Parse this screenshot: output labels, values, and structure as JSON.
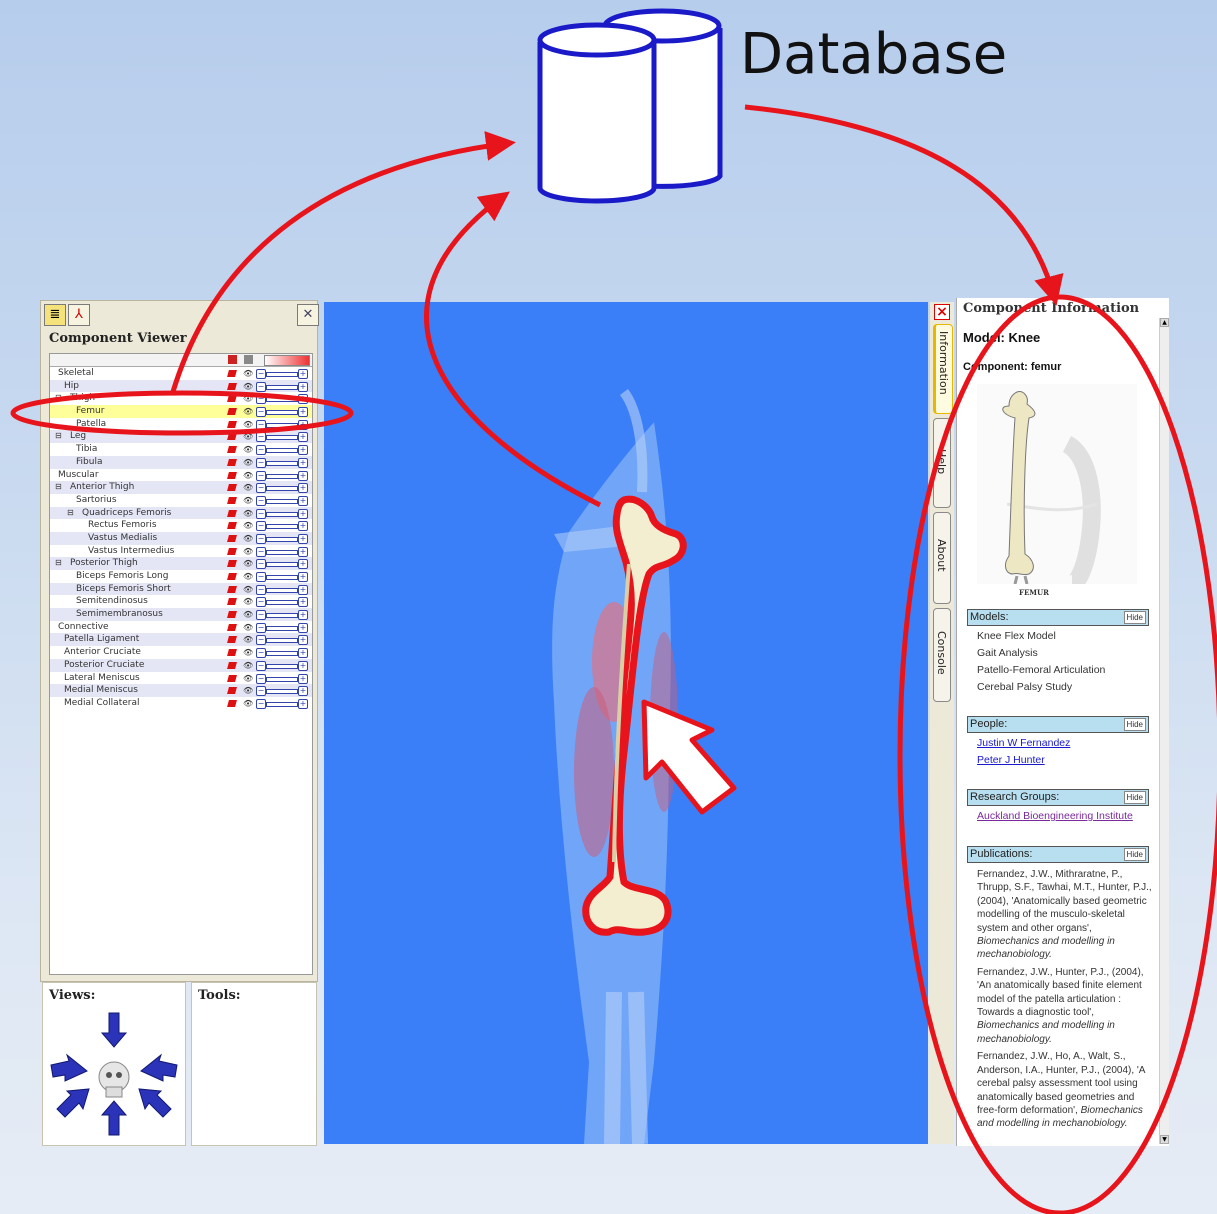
{
  "diagram": {
    "database_label": "Database"
  },
  "icons": {
    "database": "database-cylinders-icon",
    "cursor": "arrow-cursor-icon"
  },
  "colors": {
    "annotation_red": "#e8141c",
    "viewport_blue": "#3a7ef8",
    "selection_yellow": "#ffff99",
    "section_header": "#b8dfef"
  },
  "left_panel": {
    "title": "Component Viewer",
    "tree": [
      {
        "label": "Skeletal",
        "indent": 0,
        "expander": "⊟"
      },
      {
        "label": "Hip",
        "indent": 1,
        "expander": ""
      },
      {
        "label": "Thigh",
        "indent": 1,
        "expander": "⊟"
      },
      {
        "label": "Femur",
        "indent": 2,
        "expander": "",
        "selected": true
      },
      {
        "label": "Patella",
        "indent": 2,
        "expander": ""
      },
      {
        "label": "Leg",
        "indent": 1,
        "expander": "⊟"
      },
      {
        "label": "Tibia",
        "indent": 2,
        "expander": ""
      },
      {
        "label": "Fibula",
        "indent": 2,
        "expander": ""
      },
      {
        "label": "Muscular",
        "indent": 0,
        "expander": "⊟"
      },
      {
        "label": "Anterior Thigh",
        "indent": 1,
        "expander": "⊟"
      },
      {
        "label": "Sartorius",
        "indent": 2,
        "expander": ""
      },
      {
        "label": "Quadriceps Femoris",
        "indent": 2,
        "expander": "⊟"
      },
      {
        "label": "Rectus Femoris",
        "indent": 3,
        "expander": ""
      },
      {
        "label": "Vastus Medialis",
        "indent": 3,
        "expander": ""
      },
      {
        "label": "Vastus Intermedius",
        "indent": 3,
        "expander": ""
      },
      {
        "label": "Posterior Thigh",
        "indent": 1,
        "expander": "⊟"
      },
      {
        "label": "Biceps Femoris Long",
        "indent": 2,
        "expander": ""
      },
      {
        "label": "Biceps Femoris Short",
        "indent": 2,
        "expander": ""
      },
      {
        "label": "Semitendinosus",
        "indent": 2,
        "expander": ""
      },
      {
        "label": "Semimembranosus",
        "indent": 2,
        "expander": ""
      },
      {
        "label": "Connective",
        "indent": 0,
        "expander": "⊟"
      },
      {
        "label": "Patella Ligament",
        "indent": 1,
        "expander": ""
      },
      {
        "label": "Anterior Cruciate",
        "indent": 1,
        "expander": ""
      },
      {
        "label": "Posterior Cruciate",
        "indent": 1,
        "expander": ""
      },
      {
        "label": "Lateral Meniscus",
        "indent": 1,
        "expander": ""
      },
      {
        "label": "Medial Meniscus",
        "indent": 1,
        "expander": ""
      },
      {
        "label": "Medial Collateral",
        "indent": 1,
        "expander": ""
      }
    ],
    "views_title": "Views:",
    "tools_title": "Tools:"
  },
  "tabs": [
    {
      "label": "Information",
      "active": true
    },
    {
      "label": "Help",
      "active": false
    },
    {
      "label": "About",
      "active": false
    },
    {
      "label": "Console",
      "active": false
    }
  ],
  "info_panel": {
    "title": "Component Information",
    "model": "Model: Knee",
    "component": "Component: femur",
    "image_caption": "FEMUR",
    "hide_label": "Hide",
    "models_header": "Models:",
    "models": [
      "Knee Flex Model",
      "Gait Analysis",
      "Patello-Femoral Articulation",
      "Cerebal Palsy Study"
    ],
    "people_header": "People:",
    "people": [
      "Justin W Fernandez",
      "Peter J Hunter"
    ],
    "groups_header": "Research Groups:",
    "groups": [
      "Auckland Bioengineering Institute"
    ],
    "publications_header": "Publications:",
    "publications": [
      {
        "text": "Fernandez, J.W., Mithraratne, P., Thrupp, S.F., Tawhai, M.T., Hunter, P.J., (2004), 'Anatomically based geometric modelling of the musculo-skeletal system and other organs', ",
        "journal": "Biomechanics and modelling in mechanobiology."
      },
      {
        "text": "Fernandez, J.W., Hunter, P.J., (2004), 'An anatomically based finite element model of the patella articulation : Towards a diagnostic tool', ",
        "journal": "Biomechanics and modelling in mechanobiology."
      },
      {
        "text": "Fernandez, J.W., Ho, A., Walt, S., Anderson, I.A., Hunter, P.J., (2004), 'A cerebal palsy assessment tool using anatomically based geometries and free-form deformation', ",
        "journal": "Biomechanics and modelling in mechanobiology."
      }
    ]
  }
}
